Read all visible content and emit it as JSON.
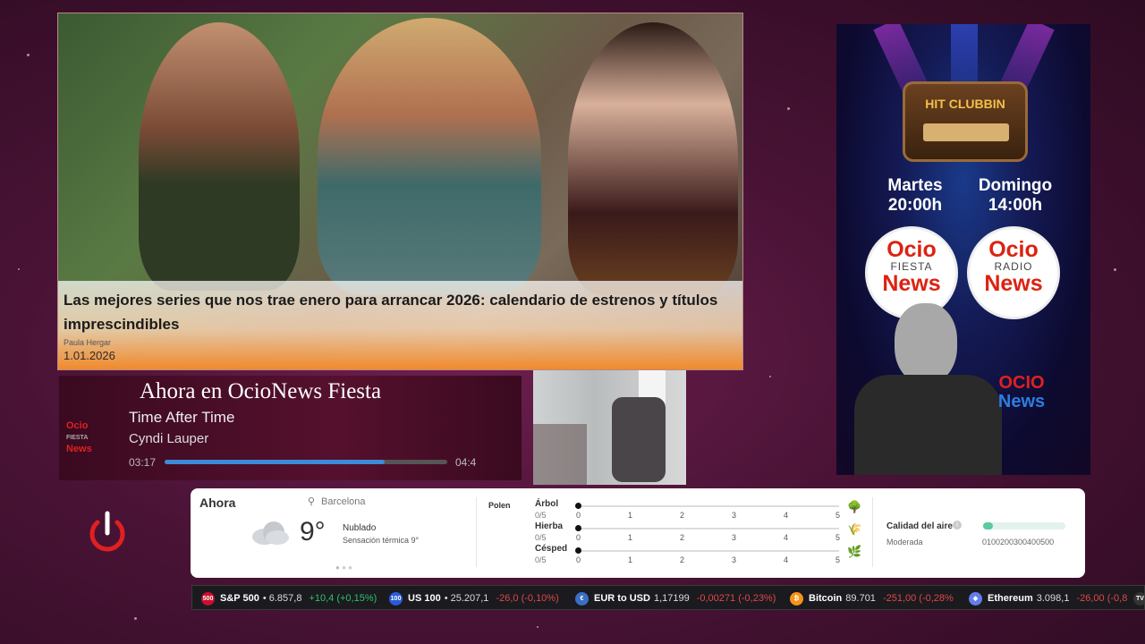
{
  "colors": {
    "accent": "#3d8ad8",
    "positive": "#2fc26a",
    "negative": "#e04848",
    "brand_red": "#d21f1f"
  },
  "hero": {
    "title": "Las mejores series que nos trae enero para arrancar 2026: calendario de estrenos y títulos imprescindibles",
    "author": "Paula Hergar",
    "date": "1.01.2026"
  },
  "now_playing": {
    "heading": "Ahora en OcioNews Fiesta",
    "title": "Time After Time",
    "artist": "Cyndi Lauper",
    "elapsed": "03:17",
    "total": "04:4",
    "progress": 0.78,
    "logo_top": "Ocio",
    "logo_mid": "FIESTA",
    "logo_bottom": "News"
  },
  "promo": {
    "radio_label": "HIT CLUBBIN",
    "day1": "Martes",
    "time1": "20:00h",
    "day2": "Domingo",
    "time2": "14:00h",
    "logo1_top": "Ocio",
    "logo1_mid": "FIESTA",
    "logo1_bottom": "News",
    "logo2_top": "Ocio",
    "logo2_mid": "RADIO",
    "logo2_bottom": "News",
    "corner_top": "OCIO",
    "corner_bottom": "News"
  },
  "power": {
    "icon": "power-icon"
  },
  "weather": {
    "now_label": "Ahora",
    "location": "Barcelona",
    "temperature": "9°",
    "condition": "Nublado",
    "feels_like": "Sensación térmica 9°",
    "icon": "cloud-icon",
    "pollen_label": "Polen",
    "pollen": [
      {
        "name": "Árbol",
        "value": "0/5",
        "level": 0,
        "icon": "tree-icon"
      },
      {
        "name": "Hierba",
        "value": "0/5",
        "level": 0,
        "icon": "grass-icon"
      },
      {
        "name": "Césped",
        "value": "0/5",
        "level": 0,
        "icon": "lawn-icon"
      }
    ],
    "scale": [
      "0",
      "1",
      "2",
      "3",
      "4",
      "5"
    ],
    "air_label": "Calidad del aire",
    "air_status": "Moderada",
    "air_scale": "0100200300400500",
    "air_level": 0.05
  },
  "ticker": [
    {
      "badge": "500",
      "name": "S&P 500",
      "value": "6.857,8",
      "change": "+10,4 (+0,15%)",
      "dir": "pos",
      "color": "#c8102e"
    },
    {
      "badge": "100",
      "name": "US 100",
      "value": "25.207,1",
      "change": "-26,0 (-0,10%)",
      "dir": "neg",
      "color": "#2b5bd7"
    },
    {
      "badge": "€",
      "name": "EUR to USD",
      "value": "1,17199",
      "change": "-0,00271 (-0,23%)",
      "dir": "neg",
      "color": "#3a6fc4"
    },
    {
      "badge": "₿",
      "name": "Bitcoin",
      "value": "89.701",
      "change": "-251,00 (-0,28%",
      "dir": "neg",
      "color": "#f7931a"
    },
    {
      "badge": "◆",
      "name": "Ethereum",
      "value": "3.098,1",
      "change": "-26,00 (-0,8",
      "dir": "neg",
      "color": "#627eea"
    },
    {
      "badge": "TV",
      "name": "",
      "value": "",
      "change": "",
      "dir": "neg",
      "color": "#333"
    }
  ]
}
